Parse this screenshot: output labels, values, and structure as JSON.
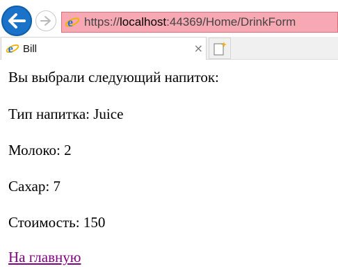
{
  "browser": {
    "url_prefix": "https://",
    "url_host": "localhost",
    "url_rest": ":44369/Home/DrinkForm",
    "tab_title": "Bill",
    "tab_close": "×"
  },
  "page": {
    "heading": "Вы выбрали следующий напиток:",
    "drink_type": "Тип напитка: Juice",
    "milk": "Молоко: 2",
    "sugar": "Сахар: 7",
    "cost": "Стоимость: 150",
    "home_link": "На главную"
  },
  "colors": {
    "address_bar_bg": "#f8a8b3",
    "back_button": "#1a73c9",
    "visited_link": "#800080"
  }
}
